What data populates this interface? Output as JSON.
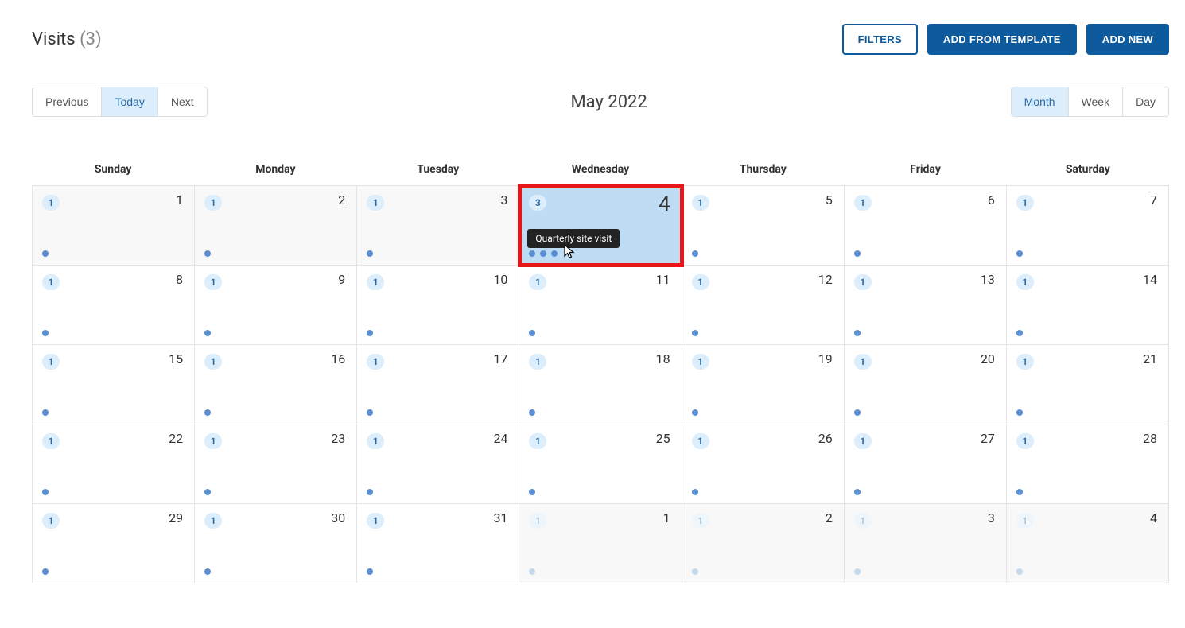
{
  "header": {
    "title_label": "Visits",
    "title_count": "(3)",
    "filters_label": "FILTERS",
    "add_template_label": "ADD FROM TEMPLATE",
    "add_new_label": "ADD NEW"
  },
  "toolbar": {
    "nav": {
      "previous": "Previous",
      "today": "Today",
      "next": "Next",
      "active": "today"
    },
    "month_title": "May 2022",
    "views": {
      "month": "Month",
      "week": "Week",
      "day": "Day",
      "active": "month"
    }
  },
  "days_of_week": [
    "Sunday",
    "Monday",
    "Tuesday",
    "Wednesday",
    "Thursday",
    "Friday",
    "Saturday"
  ],
  "tooltip_text": "Quarterly site visit",
  "weeks": [
    [
      {
        "num": "1",
        "badge": "1",
        "dots": 1,
        "out": true
      },
      {
        "num": "2",
        "badge": "1",
        "dots": 1,
        "out": true
      },
      {
        "num": "3",
        "badge": "1",
        "dots": 1,
        "out": true
      },
      {
        "num": "4",
        "badge": "3",
        "dots": 3,
        "today": true,
        "highlight": true,
        "tooltip": true,
        "cursor": true
      },
      {
        "num": "5",
        "badge": "1",
        "dots": 1
      },
      {
        "num": "6",
        "badge": "1",
        "dots": 1
      },
      {
        "num": "7",
        "badge": "1",
        "dots": 1
      }
    ],
    [
      {
        "num": "8",
        "badge": "1",
        "dots": 1
      },
      {
        "num": "9",
        "badge": "1",
        "dots": 1
      },
      {
        "num": "10",
        "badge": "1",
        "dots": 1
      },
      {
        "num": "11",
        "badge": "1",
        "dots": 1
      },
      {
        "num": "12",
        "badge": "1",
        "dots": 1
      },
      {
        "num": "13",
        "badge": "1",
        "dots": 1
      },
      {
        "num": "14",
        "badge": "1",
        "dots": 1
      }
    ],
    [
      {
        "num": "15",
        "badge": "1",
        "dots": 1
      },
      {
        "num": "16",
        "badge": "1",
        "dots": 1
      },
      {
        "num": "17",
        "badge": "1",
        "dots": 1
      },
      {
        "num": "18",
        "badge": "1",
        "dots": 1
      },
      {
        "num": "19",
        "badge": "1",
        "dots": 1
      },
      {
        "num": "20",
        "badge": "1",
        "dots": 1
      },
      {
        "num": "21",
        "badge": "1",
        "dots": 1
      }
    ],
    [
      {
        "num": "22",
        "badge": "1",
        "dots": 1
      },
      {
        "num": "23",
        "badge": "1",
        "dots": 1
      },
      {
        "num": "24",
        "badge": "1",
        "dots": 1
      },
      {
        "num": "25",
        "badge": "1",
        "dots": 1
      },
      {
        "num": "26",
        "badge": "1",
        "dots": 1
      },
      {
        "num": "27",
        "badge": "1",
        "dots": 1
      },
      {
        "num": "28",
        "badge": "1",
        "dots": 1
      }
    ],
    [
      {
        "num": "29",
        "badge": "1",
        "dots": 1
      },
      {
        "num": "30",
        "badge": "1",
        "dots": 1
      },
      {
        "num": "31",
        "badge": "1",
        "dots": 1
      },
      {
        "num": "1",
        "badge": "1",
        "dots": 1,
        "out": true,
        "faded": true
      },
      {
        "num": "2",
        "badge": "1",
        "dots": 1,
        "out": true,
        "faded": true
      },
      {
        "num": "3",
        "badge": "1",
        "dots": 1,
        "out": true,
        "faded": true
      },
      {
        "num": "4",
        "badge": "1",
        "dots": 1,
        "out": true,
        "faded": true
      }
    ]
  ]
}
